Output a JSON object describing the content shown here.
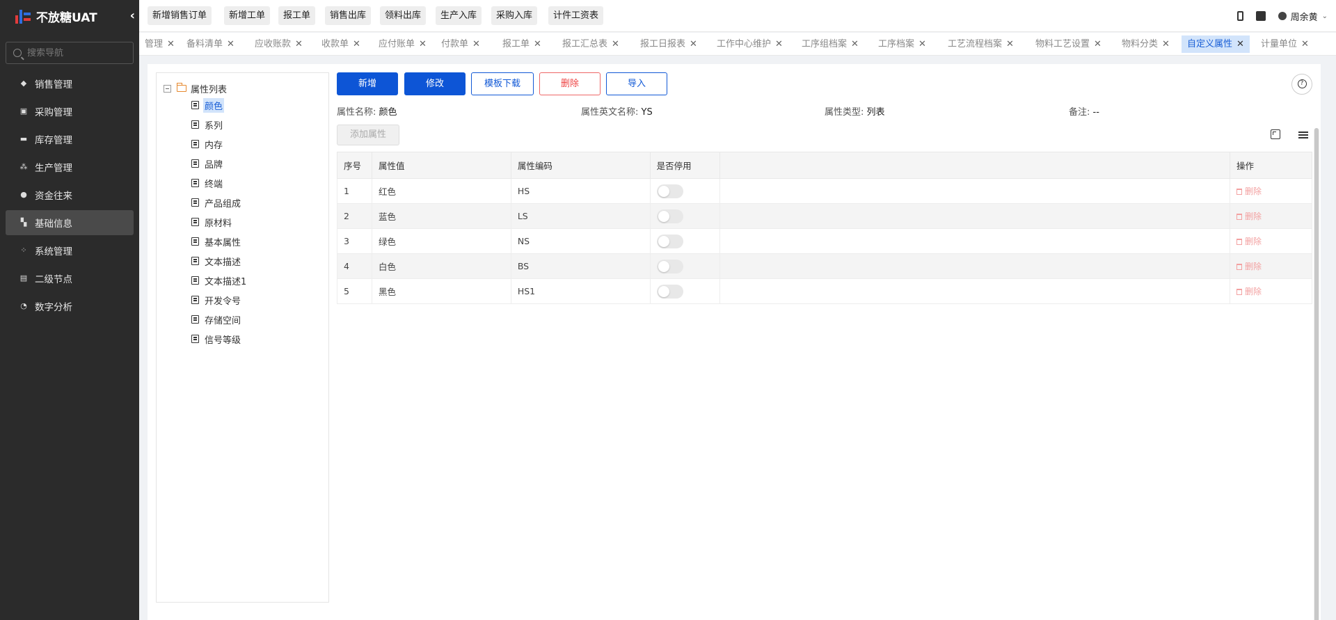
{
  "brand": {
    "name": "不放糖UAT",
    "collapse_icon": "chevron-left-icon"
  },
  "search": {
    "placeholder": "搜索导航"
  },
  "sidebar": {
    "items": [
      {
        "label": "销售管理",
        "icon": "tag-icon"
      },
      {
        "label": "采购管理",
        "icon": "cart-icon"
      },
      {
        "label": "库存管理",
        "icon": "warehouse-icon"
      },
      {
        "label": "生产管理",
        "icon": "production-icon"
      },
      {
        "label": "资金往来",
        "icon": "money-icon"
      },
      {
        "label": "基础信息",
        "icon": "grid-icon",
        "active": true
      },
      {
        "label": "系统管理",
        "icon": "apps-icon"
      },
      {
        "label": "二级节点",
        "icon": "list-icon"
      },
      {
        "label": "数字分析",
        "icon": "pie-icon"
      }
    ]
  },
  "quick_actions": [
    "新增销售订单",
    "新增工单",
    "报工单",
    "销售出库",
    "领料出库",
    "生产入库",
    "采购入库",
    "计件工资表"
  ],
  "user": {
    "name": "周余黄"
  },
  "tabs": [
    "管理",
    "备料清单",
    "应收账款",
    "收款单",
    "应付账单",
    "付款单",
    "报工单",
    "报工汇总表",
    "报工日报表",
    "工作中心维护",
    "工序组档案",
    "工序档案",
    "工艺流程档案",
    "物料工艺设置",
    "物料分类",
    "自定义属性",
    "计量单位"
  ],
  "active_tab": "自定义属性",
  "tree": {
    "root": "属性列表",
    "nodes": [
      "颜色",
      "系列",
      "内存",
      "品牌",
      "终端",
      "产品组成",
      "原材料",
      "基本属性",
      "文本描述",
      "文本描述1",
      "开发令号",
      "存储空间",
      "信号等级"
    ],
    "selected": "颜色"
  },
  "toolbar": {
    "add": "新增",
    "edit": "修改",
    "template": "模板下载",
    "delete": "删除",
    "import": "导入",
    "add_attr": "添加属性"
  },
  "info": {
    "name_label": "属性名称:",
    "name_value": "颜色",
    "en_label": "属性英文名称:",
    "en_value": "YS",
    "type_label": "属性类型:",
    "type_value": "列表",
    "remark_label": "备注:",
    "remark_value": "--"
  },
  "table": {
    "headers": [
      "序号",
      "属性值",
      "属性编码",
      "是否停用",
      "",
      "操作"
    ],
    "rows": [
      {
        "no": "1",
        "value": "红色",
        "code": "HS",
        "disabled": false,
        "action": "删除"
      },
      {
        "no": "2",
        "value": "蓝色",
        "code": "LS",
        "disabled": false,
        "action": "删除"
      },
      {
        "no": "3",
        "value": "绿色",
        "code": "NS",
        "disabled": false,
        "action": "删除"
      },
      {
        "no": "4",
        "value": "白色",
        "code": "BS",
        "disabled": false,
        "action": "删除"
      },
      {
        "no": "5",
        "value": "黑色",
        "code": "HS1",
        "disabled": false,
        "action": "删除"
      }
    ]
  },
  "colors": {
    "primary": "#0d55d6",
    "sidebar": "#2b2b2b",
    "danger": "#e44444",
    "tab_active_bg": "#d2e4fb"
  }
}
